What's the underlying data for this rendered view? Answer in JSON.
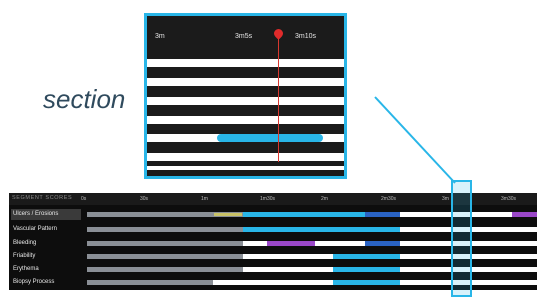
{
  "colors": {
    "accent": "#29b6e8",
    "gray": "#8a8f96",
    "blue": "#29b6e8",
    "navy": "#2a63c4",
    "purple": "#9b48c9",
    "white": "#ffffff",
    "playhead": "#e02b2b"
  },
  "zoom": {
    "ticks": [
      "3m",
      "3m5s",
      "3m10s"
    ]
  },
  "annotation": {
    "section_label": "section"
  },
  "timeline": {
    "title": "SEGMENT SCORES",
    "ticks": [
      "0s",
      "30s",
      "1m",
      "1m30s",
      "2m",
      "2m30s",
      "3m",
      "3m30s"
    ],
    "rows": [
      {
        "label": "Ulcers / Erosions",
        "active": true
      },
      {
        "label": "Vascular Pattern",
        "active": false
      },
      {
        "label": "Bleeding",
        "active": false
      },
      {
        "label": "Friability",
        "active": false
      },
      {
        "label": "Erythema",
        "active": false
      },
      {
        "label": "Biopsy Process",
        "active": false
      }
    ]
  }
}
